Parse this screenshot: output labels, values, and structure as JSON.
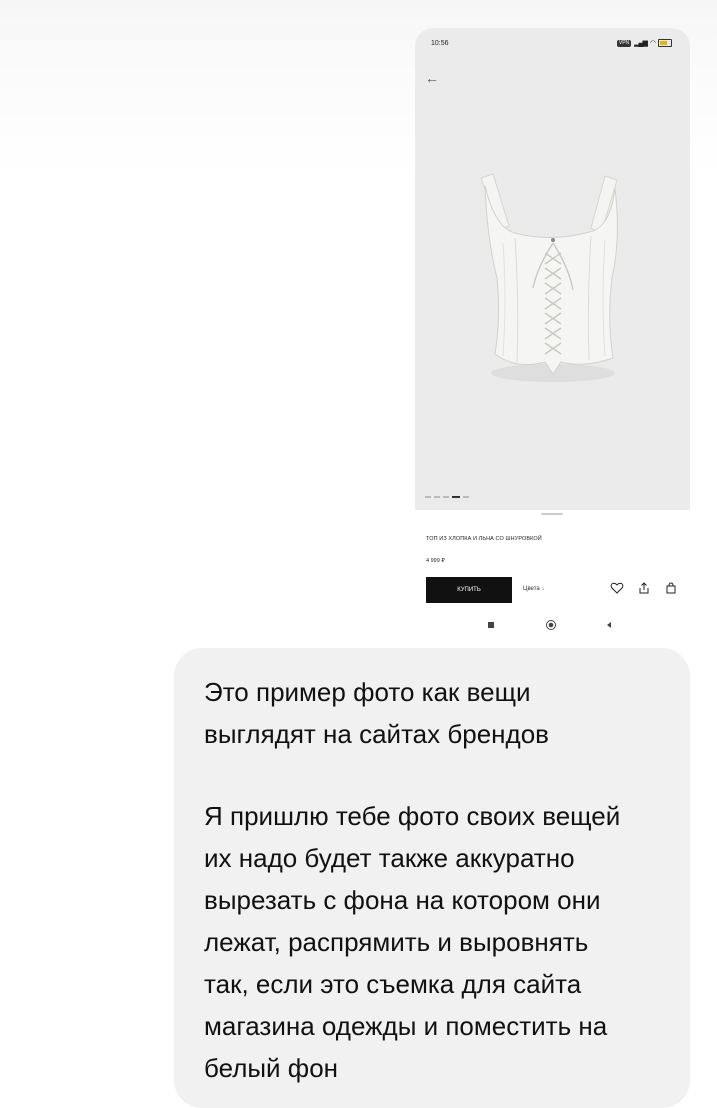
{
  "phone": {
    "status": {
      "time": "10:56",
      "vpn": "VPN"
    },
    "product": {
      "title": "ТОП ИЗ ХЛОПКА И ЛЬНА СО ШНУРОВКОЙ",
      "price": "4 999 ₽",
      "buy_label": "КУПИТЬ",
      "color_label": "Цвета",
      "carousel": {
        "count": 5,
        "active_index": 3
      }
    },
    "icons": {
      "back": "arrow-left-icon",
      "favorite": "heart-icon",
      "share": "share-icon",
      "bag": "shopping-bag-icon",
      "nav_recent": "square-icon",
      "nav_home": "circle-icon",
      "nav_back": "triangle-back-icon"
    }
  },
  "message": {
    "paragraph1": "Это пример фото как вещи\nвыглядят на сайтах брендов",
    "paragraph2": "Я пришлю тебе фото своих вещей\nих надо будет также аккуратно\nвырезать с фона на котором они\nлежат, распрямить и выровнять\nтак, если это съемка для сайта\nмагазина одежды и поместить на\nбелый фон"
  },
  "colors": {
    "bubble_bg": "#f1f1f1",
    "photo_bg": "#ebebeb",
    "buy_button": "#111111"
  }
}
